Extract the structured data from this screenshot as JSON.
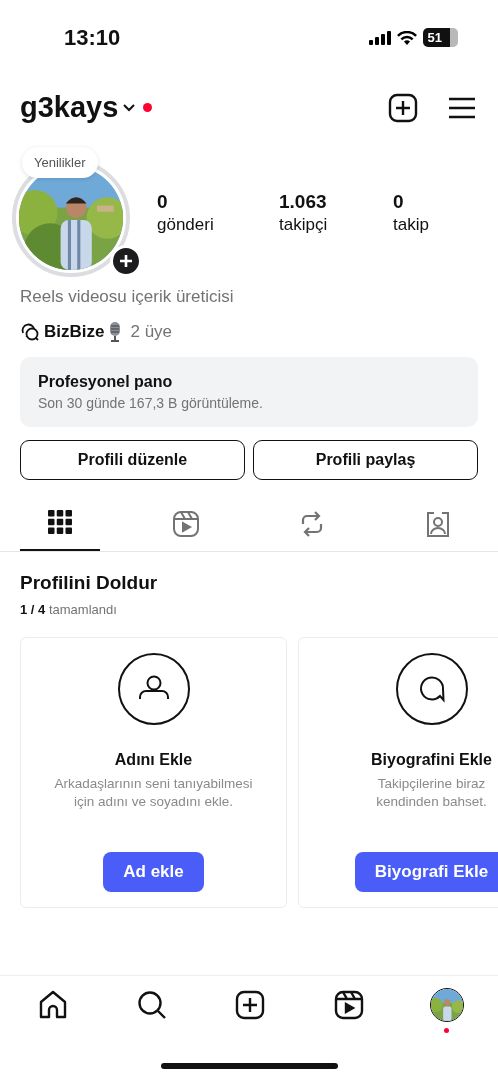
{
  "status_bar": {
    "time": "13:10",
    "battery": "51"
  },
  "header": {
    "username": "g3kays",
    "notification_dot": true
  },
  "profile": {
    "note": "Yenilikler",
    "stats": [
      {
        "value": "0",
        "label": "gönderi"
      },
      {
        "value": "1.063",
        "label": "takipçi"
      },
      {
        "value": "0",
        "label": "takip"
      }
    ],
    "bio": "Reels videosu içerik üreticisi",
    "channel": {
      "name": "BizBize",
      "members": "2 üye"
    }
  },
  "dashboard": {
    "title": "Profesyonel pano",
    "subtitle": "Son 30 günde 167,3 B görüntüleme."
  },
  "buttons": [
    "Profili düzenle",
    "Profili paylaş"
  ],
  "tabs": [
    {
      "kind": "grid",
      "selected": true
    },
    {
      "kind": "reels",
      "selected": false
    },
    {
      "kind": "reposts",
      "selected": false
    },
    {
      "kind": "tagged",
      "selected": false
    }
  ],
  "complete": {
    "title": "Profilini Doldur",
    "progress": "**1 / 4** tamamlandı",
    "cards": [
      {
        "kind": "person",
        "title": "Adını Ekle",
        "text": "Arkadaşlarının seni tanıyabilmesi\niçin adını ve soyadını ekle.",
        "button": "Ad ekle"
      },
      {
        "kind": "bubble",
        "title": "Biyografini Ekle",
        "text": "Takipçilerine biraz\nkendinden bahset.",
        "button": "Biyografi Ekle"
      }
    ]
  },
  "nav": [
    {
      "kind": "home",
      "badge": false
    },
    {
      "kind": "search",
      "badge": false
    },
    {
      "kind": "create",
      "badge": false
    },
    {
      "kind": "reels",
      "badge": false
    },
    {
      "kind": "profile",
      "badge": true
    }
  ]
}
